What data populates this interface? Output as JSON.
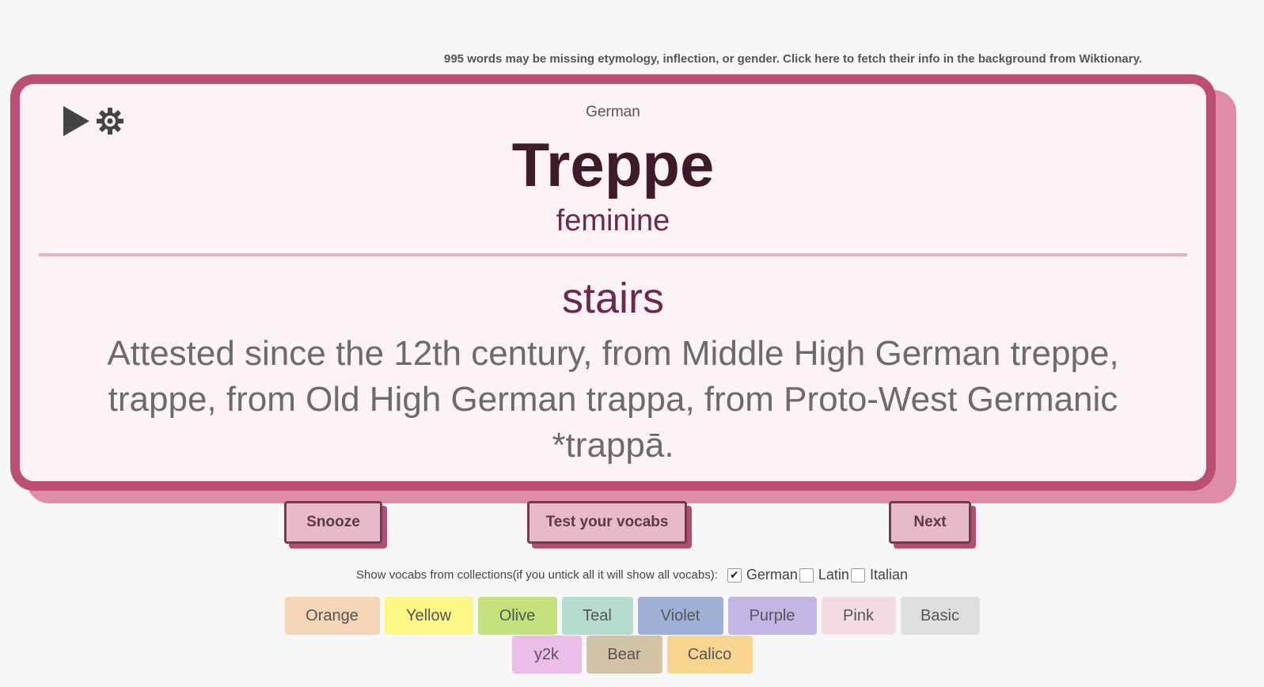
{
  "notice": "995 words may be missing etymology, inflection, or gender. Click here to fetch their info in the background from Wiktionary.",
  "card": {
    "controls": {
      "play_icon": "play-icon",
      "settings_icon": "gear-icon"
    },
    "language": "German",
    "word": "Treppe",
    "gender": "feminine",
    "translation": "stairs",
    "etymology": "Attested since the 12th century, from Middle High German treppe, trappe, from Old High German trappa, from Proto-West Germanic *trappā."
  },
  "buttons": {
    "snooze": "Snooze",
    "test": "Test your vocabs",
    "next": "Next"
  },
  "collections": {
    "label": "Show vocabs from collections(if you untick all it will show all vocabs):",
    "items": [
      {
        "label": "German",
        "checked": true
      },
      {
        "label": "Latin",
        "checked": false
      },
      {
        "label": "Italian",
        "checked": false
      }
    ]
  },
  "themes": {
    "row1": [
      {
        "label": "Orange",
        "color": "#f5d5b5"
      },
      {
        "label": "Yellow",
        "color": "#fbf786"
      },
      {
        "label": "Olive",
        "color": "#c5e17c"
      },
      {
        "label": "Teal",
        "color": "#b6dcd2"
      },
      {
        "label": "Violet",
        "color": "#9fb0d4"
      },
      {
        "label": "Purple",
        "color": "#c2b5e4"
      },
      {
        "label": "Pink",
        "color": "#f2dbe2"
      },
      {
        "label": "Basic",
        "color": "#dedede"
      }
    ],
    "row2": [
      {
        "label": "y2k",
        "color": "#ecbde9"
      },
      {
        "label": "Bear",
        "color": "#d1c3a5"
      },
      {
        "label": "Calico",
        "color": "#f8d58f"
      }
    ]
  }
}
